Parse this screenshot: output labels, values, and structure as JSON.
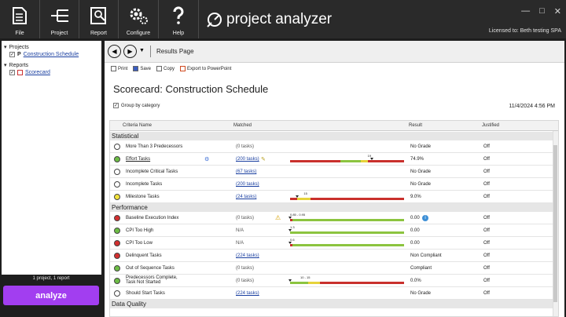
{
  "ribbon": {
    "buttons": [
      {
        "label": "File",
        "icon": "file-icon"
      },
      {
        "label": "Project",
        "icon": "project-icon"
      },
      {
        "label": "Report",
        "icon": "report-icon"
      },
      {
        "label": "Configure",
        "icon": "gear-icon"
      },
      {
        "label": "Help",
        "icon": "help-icon"
      }
    ],
    "brand": "project analyzer",
    "license": "Licensed to: Beth testing SPA"
  },
  "tree": {
    "projects_label": "Projects",
    "project_item": "Construction Schedule",
    "reports_label": "Reports",
    "report_item": "Scorecard"
  },
  "status": {
    "count": "1 project, 1 report"
  },
  "analyze_label": "analyze",
  "nav": {
    "title": "Results Page"
  },
  "toolbar": {
    "print": "Print",
    "save": "Save",
    "copy": "Copy",
    "export": "Export to PowerPoint"
  },
  "page": {
    "title": "Scorecard: Construction Schedule",
    "group_by": "Group by category",
    "date": "11/4/2024 4:56 PM"
  },
  "table": {
    "headers": {
      "criteria": "Criteria Name",
      "matched": "Matched",
      "result": "Result",
      "justified": "Justified"
    },
    "categories": [
      "Statistical",
      "Performance",
      "Data Quality"
    ],
    "rows": [
      {
        "criteria": "More Than 3 Predecessors",
        "matched": "(0 tasks)",
        "result": "No Grade",
        "justified": "Off",
        "status": "none"
      },
      {
        "criteria": "Effort Tasks",
        "matched": "(200 tasks)",
        "result": "74.9%",
        "justified": "Off",
        "status": "green",
        "bar_label": "19"
      },
      {
        "criteria": "Incomplete Critical Tasks",
        "matched": "(67 tasks)",
        "result": "No Grade",
        "justified": "Off",
        "status": "none"
      },
      {
        "criteria": "Incomplete Tasks",
        "matched": "(200 tasks)",
        "result": "No Grade",
        "justified": "Off",
        "status": "none"
      },
      {
        "criteria": "Milestone Tasks",
        "matched": "(24 tasks)",
        "result": "9.0%",
        "justified": "Off",
        "status": "yellow",
        "bar_label": "15"
      },
      {
        "criteria": "Baseline Execution Index",
        "matched": "(0 tasks)",
        "result": "0.00",
        "justified": "Off",
        "status": "red",
        "bar_label": "0.85 - 0.95"
      },
      {
        "criteria": "CPI Too High",
        "matched": "N/A",
        "result": "0.00",
        "justified": "Off",
        "status": "green",
        "bar_label": "1.3"
      },
      {
        "criteria": "CPI Too Low",
        "matched": "N/A",
        "result": "0.00",
        "justified": "Off",
        "status": "red",
        "bar_label": "0.6"
      },
      {
        "criteria": "Delinquent Tasks",
        "matched": "(224 tasks)",
        "result": "Non Compliant",
        "justified": "Off",
        "status": "red"
      },
      {
        "criteria": "Out of Sequence Tasks",
        "matched": "(0 tasks)",
        "result": "Compliant",
        "justified": "Off",
        "status": "green"
      },
      {
        "criteria": "Predecessors Complete, Task Not Started",
        "matched": "(0 tasks)",
        "result": "0.0%",
        "justified": "Off",
        "status": "green",
        "bar_label": "10 - 15"
      },
      {
        "criteria": "Should Start Tasks",
        "matched": "(224 tasks)",
        "result": "No Grade",
        "justified": "Off",
        "status": "none"
      }
    ]
  },
  "colors": {
    "accent": "#a23ef0",
    "green": "#6dbd45",
    "red": "#d32f2f",
    "yellow": "#f2e23a",
    "bar_green": "#8cc43f",
    "bar_red": "#c9302c",
    "bar_yellow": "#e6d33a"
  }
}
